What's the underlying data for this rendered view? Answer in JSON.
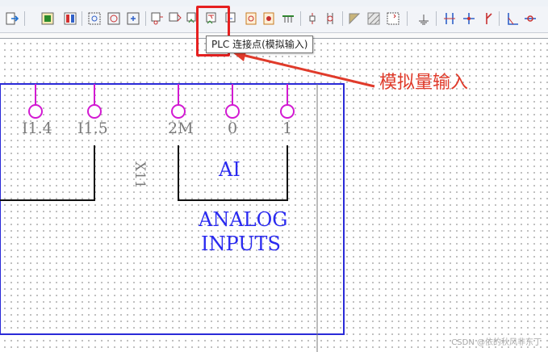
{
  "toolbar": {
    "buttons": [
      {
        "name": "export-icon"
      },
      {
        "name": "device-icon"
      },
      {
        "name": "plc-card-icon"
      },
      {
        "name": "plc-box-icon"
      },
      {
        "name": "plc-io-icon"
      },
      {
        "name": "plc-power-icon"
      },
      {
        "name": "plc-connection-icon"
      },
      {
        "name": "plc-connection-digital-out-icon"
      },
      {
        "name": "plc-connection-analog-in-icon"
      },
      {
        "name": "plc-connection-analog-out-icon"
      },
      {
        "name": "plc-changeover-icon"
      },
      {
        "name": "plc-power-supply-icon"
      },
      {
        "name": "bus-port-icon"
      },
      {
        "name": "terminal-icon"
      },
      {
        "name": "terminal-multi-icon"
      },
      {
        "name": "structure-box-icon"
      },
      {
        "name": "hatch-icon"
      },
      {
        "name": "black-box-icon"
      },
      {
        "name": "ground-icon"
      },
      {
        "name": "interrupt-icon"
      },
      {
        "name": "cross-icon"
      },
      {
        "name": "branch-icon"
      },
      {
        "name": "angle-icon"
      },
      {
        "name": "node-icon"
      }
    ]
  },
  "tooltip": {
    "text": "PLC 连接点(模拟输入)"
  },
  "annotation": {
    "text": "模拟量输入"
  },
  "schematic": {
    "pins": [
      {
        "label": "I1.4"
      },
      {
        "label": "I1.5"
      },
      {
        "label": "2M"
      },
      {
        "label": "0"
      },
      {
        "label": "1"
      }
    ],
    "vertical_label": "X11",
    "block_title": "AI",
    "block_caption_line1": "ANALOG",
    "block_caption_line2": "INPUTS"
  },
  "watermark": "CSDN @依的秋风非东丁",
  "colors": {
    "pin": "#d21ad2",
    "frame": "#2a2ad8",
    "highlight": "#e62020",
    "annotation": "#e03a2a",
    "block_text": "#2a2af0"
  }
}
